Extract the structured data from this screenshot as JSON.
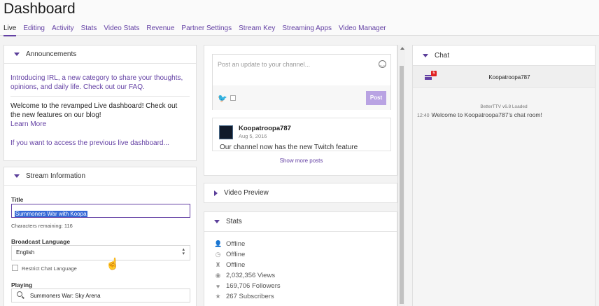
{
  "header": {
    "title": "Dashboard",
    "tabs": [
      "Live",
      "Editing",
      "Activity",
      "Stats",
      "Video Stats",
      "Revenue",
      "Partner Settings",
      "Stream Key",
      "Streaming Apps",
      "Video Manager"
    ],
    "active_tab": "Live"
  },
  "announcements": {
    "title": "Announcements",
    "irl_text": "Introducing IRL, a new category to share your thoughts, opinions, and daily life. Check out our FAQ.",
    "revamp_text": "Welcome to the revamped Live dashboard! Check out the new features on our blog!",
    "learn_more": "Learn More",
    "previous_link": "If you want to access the previous live dashboard..."
  },
  "stream_info": {
    "title": "Stream Information",
    "title_label": "Title",
    "title_value": "Summoners War with Koopa",
    "chars_remaining": "Characters remaining: 116",
    "language_label": "Broadcast Language",
    "language_value": "English",
    "restrict_label": "Restrict Chat Language",
    "playing_label": "Playing",
    "playing_value": "Summoners War: Sky Arena"
  },
  "feed": {
    "placeholder": "Post an update to your channel...",
    "post_button": "Post",
    "post_author": "Koopatroopa787",
    "post_date": "Aug 5, 2016",
    "post_text": "Our channel now has the new Twitch feature",
    "show_more": "Show more posts"
  },
  "video_preview": {
    "title": "Video Preview"
  },
  "stats": {
    "title": "Stats",
    "rows": [
      {
        "icon": "user-icon",
        "value": "Offline"
      },
      {
        "icon": "clock-icon",
        "value": "Offline"
      },
      {
        "icon": "people-icon",
        "value": "Offline"
      },
      {
        "icon": "eye-icon",
        "value": "2,032,356 Views"
      },
      {
        "icon": "heart-icon",
        "value": "169,706 Followers"
      },
      {
        "icon": "star-icon",
        "value": "267 Subscribers"
      }
    ]
  },
  "chat": {
    "title": "Chat",
    "room_name": "Koopatroopa787",
    "badge_count": "5",
    "loaded_msg": "BetterTTV v6.8 Loaded",
    "time": "12:40",
    "welcome_msg": "Welcome to Koopatroopa787's chat room!"
  },
  "colors": {
    "accent": "#6441a4",
    "post_button": "#b9a3e3",
    "twitter": "#1da1f2"
  }
}
